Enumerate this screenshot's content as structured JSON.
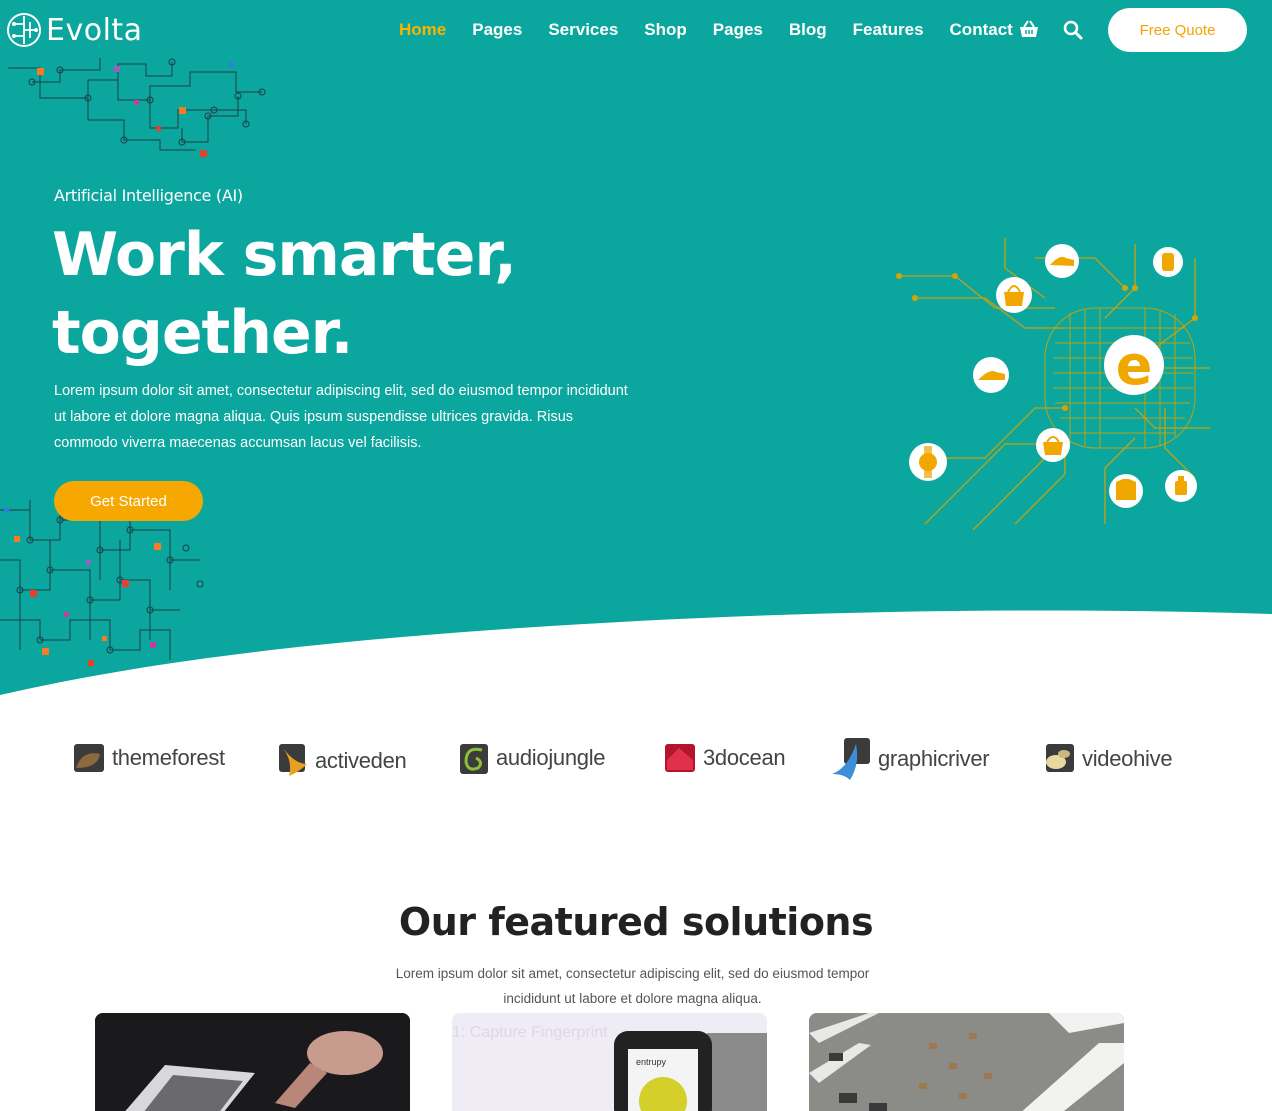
{
  "colors": {
    "brand_teal": "#0ba69d",
    "accent": "#f7a800",
    "nav_active": "#f7b500"
  },
  "header": {
    "logo_text": "Evolta",
    "nav": [
      {
        "label": "Home",
        "active": true
      },
      {
        "label": "Pages",
        "active": false
      },
      {
        "label": "Services",
        "active": false
      },
      {
        "label": "Shop",
        "active": false
      },
      {
        "label": "Pages",
        "active": false
      },
      {
        "label": "Blog",
        "active": false
      },
      {
        "label": "Features",
        "active": false
      },
      {
        "label": "Contact",
        "active": false
      }
    ],
    "icons": [
      "basket-icon",
      "search-icon"
    ],
    "quote_button": "Free Quote"
  },
  "hero": {
    "eyebrow": "Artificial Intelligence (AI)",
    "headline_line1": "Work smarter,",
    "headline_line2": "together.",
    "intro": "Lorem ipsum dolor sit amet, consectetur adipiscing elit, sed do eiusmod tempor incididunt ut labore et dolore magna aliqua. Quis ipsum suspendisse ultrices gravida. Risus commodo viverra maecenas accumsan lacus vel facilisis.",
    "cta": "Get Started",
    "illustration_center_letter": "e"
  },
  "brands": [
    {
      "name": "themeforest",
      "icon": "themeforest-logo-icon"
    },
    {
      "name": "activeden",
      "icon": "activeden-logo-icon"
    },
    {
      "name": "audiojungle",
      "icon": "audiojungle-logo-icon"
    },
    {
      "name": "3docean",
      "icon": "3docean-logo-icon"
    },
    {
      "name": "graphicriver",
      "icon": "graphicriver-logo-icon"
    },
    {
      "name": "videohive",
      "icon": "videohive-logo-icon"
    }
  ],
  "featured": {
    "title": "Our featured solutions",
    "subtitle_line1": "Lorem ipsum dolor sit amet, consectetur adipiscing elit, sed do eiusmod tempor",
    "subtitle_line2": "incididunt ut labore et dolore magna aliqua.",
    "cards": [
      {
        "image": "tablet-photo"
      },
      {
        "image": "phone-photo",
        "overlay_text": "1: Capture Fingerprint",
        "phone_text": "entrupy"
      },
      {
        "image": "warehouse-photo"
      }
    ]
  }
}
